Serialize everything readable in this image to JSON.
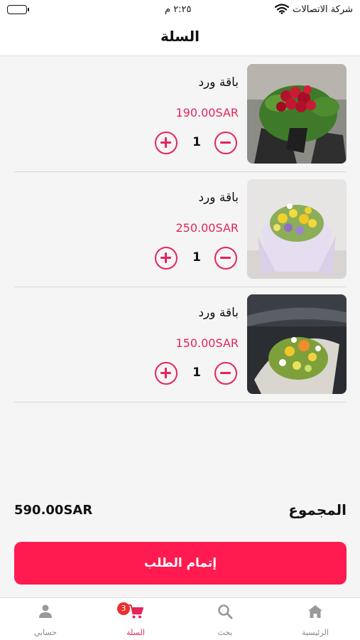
{
  "status_bar": {
    "carrier": "شركة الاتصالات",
    "time": "٢:٢٥ م"
  },
  "header": {
    "title": "السلة"
  },
  "cart": {
    "items": [
      {
        "name": "باقة ورد",
        "price": "190.00SAR",
        "quantity": "1",
        "photo": "red-rose-bouquet"
      },
      {
        "name": "باقة ورد",
        "price": "250.00SAR",
        "quantity": "1",
        "photo": "yellow-purple-bouquet"
      },
      {
        "name": "باقة ورد",
        "price": "150.00SAR",
        "quantity": "1",
        "photo": "mixed-flowers-bouquet"
      }
    ],
    "total_label": "المجموع",
    "total_value": "590.00SAR",
    "checkout_label": "إتمام الطلب"
  },
  "tab_bar": {
    "home_label": "الرئيسية",
    "search_label": "بحث",
    "cart_label": "السلة",
    "cart_badge": "3",
    "account_label": "حسابي",
    "active_tab": "cart"
  },
  "colors": {
    "accent": "#e5245a",
    "checkout": "#ff1a50",
    "badge": "#e8322e"
  }
}
